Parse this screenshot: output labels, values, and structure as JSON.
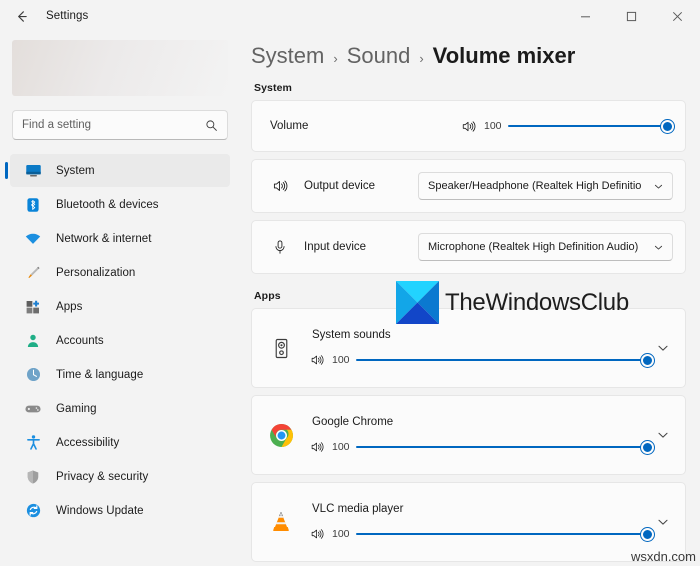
{
  "window": {
    "title": "Settings",
    "back_icon": "back-arrow-icon",
    "minimize_label": "Minimize",
    "maximize_label": "Maximize",
    "close_label": "Close"
  },
  "sidebar": {
    "search": {
      "placeholder": "Find a setting",
      "value": "",
      "icon": "search-icon"
    },
    "items": [
      {
        "label": "System",
        "icon": "monitor-icon",
        "active": true
      },
      {
        "label": "Bluetooth & devices",
        "icon": "bluetooth-icon",
        "active": false
      },
      {
        "label": "Network & internet",
        "icon": "wifi-icon",
        "active": false
      },
      {
        "label": "Personalization",
        "icon": "paintbrush-icon",
        "active": false
      },
      {
        "label": "Apps",
        "icon": "apps-grid-icon",
        "active": false
      },
      {
        "label": "Accounts",
        "icon": "person-icon",
        "active": false
      },
      {
        "label": "Time & language",
        "icon": "clock-globe-icon",
        "active": false
      },
      {
        "label": "Gaming",
        "icon": "gamepad-icon",
        "active": false
      },
      {
        "label": "Accessibility",
        "icon": "accessibility-icon",
        "active": false
      },
      {
        "label": "Privacy & security",
        "icon": "shield-icon",
        "active": false
      },
      {
        "label": "Windows Update",
        "icon": "update-refresh-icon",
        "active": false
      }
    ]
  },
  "breadcrumb": {
    "crumb1": "System",
    "sep1": "›",
    "crumb2": "Sound",
    "sep2": "›",
    "current": "Volume mixer"
  },
  "system_section": {
    "label": "System",
    "volume_row": {
      "label": "Volume",
      "icon": "speaker-volume-icon",
      "value": "100",
      "percent": 100
    },
    "output_row": {
      "label": "Output device",
      "icon": "speaker-volume-icon",
      "value": "Speaker/Headphone (Realtek High Definitio",
      "chevron": "chevron-down-icon"
    },
    "input_row": {
      "label": "Input device",
      "icon": "microphone-icon",
      "value": "Microphone (Realtek High Definition Audio)",
      "chevron": "chevron-down-icon"
    }
  },
  "apps_section": {
    "label": "Apps",
    "items": [
      {
        "name": "System sounds",
        "icon": "system-speaker-icon",
        "volume_icon": "speaker-volume-icon",
        "value": "100",
        "percent": 100,
        "chevron": "chevron-down-icon"
      },
      {
        "name": "Google Chrome",
        "icon": "chrome-icon",
        "volume_icon": "speaker-volume-icon",
        "value": "100",
        "percent": 100,
        "chevron": "chevron-down-icon"
      },
      {
        "name": "VLC media player",
        "icon": "vlc-cone-icon",
        "volume_icon": "speaker-volume-icon",
        "value": "100",
        "percent": 100,
        "chevron": "chevron-down-icon"
      }
    ]
  },
  "watermarks": {
    "logo_text": "TheWindowsClub",
    "logo_icon": "thewindowsclub-logo-icon",
    "bottom_text": "wsxdn.com"
  },
  "colors": {
    "accent": "#0067c0",
    "window_bg": "#f3f3f3",
    "card_bg": "#fbfbfb",
    "text": "#1b1b1b"
  }
}
